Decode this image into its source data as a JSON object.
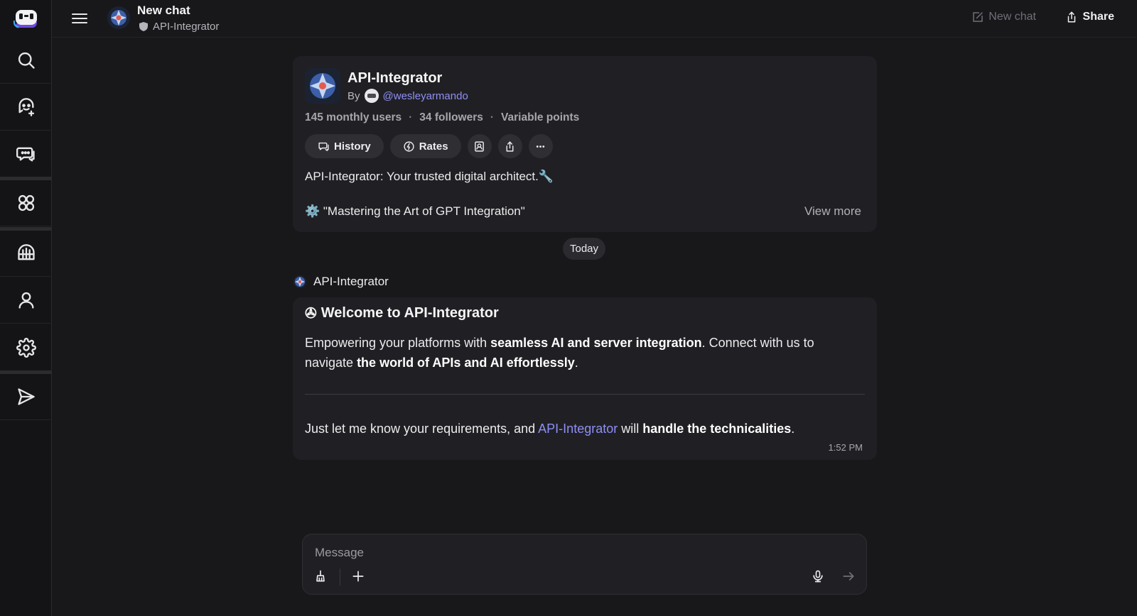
{
  "header": {
    "title": "New chat",
    "bot_name": "API-Integrator",
    "new_chat_label": "New chat",
    "share_label": "Share"
  },
  "sidebar": {
    "items": [
      {
        "name": "search-icon"
      },
      {
        "name": "add-bot-icon"
      },
      {
        "name": "chats-icon"
      },
      {
        "name": "apps-icon"
      },
      {
        "name": "create-bot-icon"
      },
      {
        "name": "profile-icon"
      },
      {
        "name": "settings-icon"
      },
      {
        "name": "send-icon"
      }
    ]
  },
  "bot": {
    "name": "API-Integrator",
    "by_label": "By",
    "handle": "@wesleyarmando",
    "stats": [
      "145 monthly users",
      "34 followers",
      "Variable points"
    ],
    "history_label": "History",
    "rates_label": "Rates",
    "description": "API-Integrator: Your trusted digital architect.🔧",
    "quote": "⚙️ \"Mastering the Art of GPT Integration\"",
    "view_more": "View more"
  },
  "divider_label": "Today",
  "message": {
    "sender": "API-Integrator",
    "heading_icon": "✇",
    "heading": "Welcome to API-Integrator",
    "para1_a": "Empowering your platforms with ",
    "para1_b": "seamless AI and server integration",
    "para1_c": ". Connect with us to navigate ",
    "para1_d": "the world of APIs and AI effortlessly",
    "para1_e": ".",
    "para2_a": "Just let me know your requirements, and ",
    "para2_link": "API-Integrator",
    "para2_b": " will ",
    "para2_c": "handle the technicalities",
    "para2_d": ".",
    "time": "1:52 PM"
  },
  "composer": {
    "placeholder": "Message"
  },
  "colors": {
    "background": "#18181b",
    "card": "#202024",
    "accent": "#8f8ff5"
  }
}
